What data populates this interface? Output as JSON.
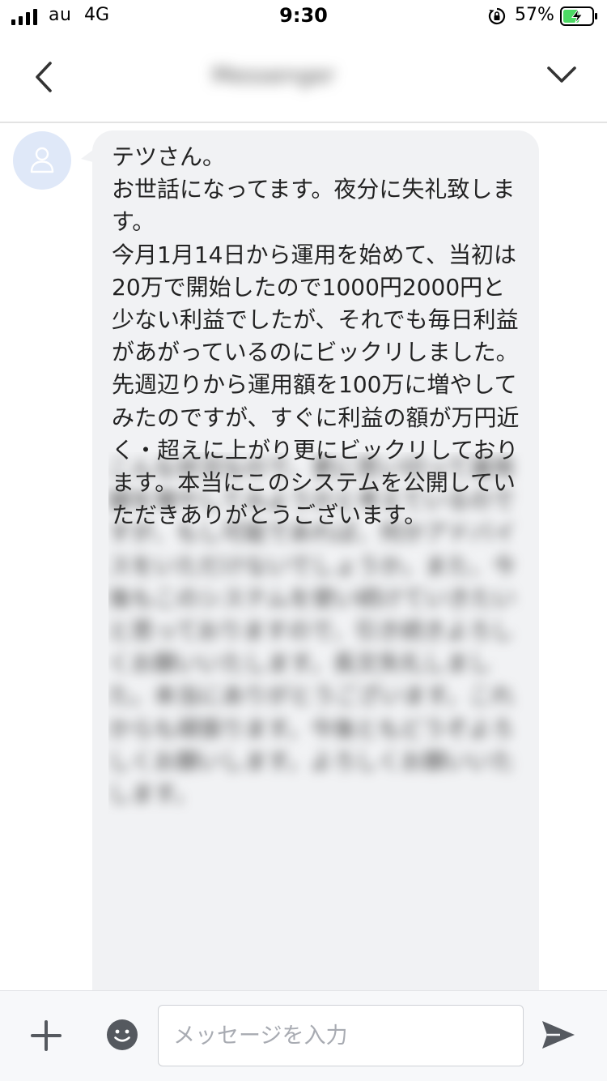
{
  "status_bar": {
    "carrier": "au",
    "network": "4G",
    "time": "9:30",
    "battery_percent": "57%",
    "signal_bars": 4,
    "battery_level": 0.57,
    "charging": true
  },
  "nav": {
    "title": "Messenger"
  },
  "message": {
    "sender_avatar": "person-icon",
    "text": "テツさん。\nお世話になってます。夜分に失礼致します。\n今月1月14日から運用を始めて、当初は20万で開始したので1000円2000円と少ない利益でしたが、それでも毎日利益があがっているのにビックリしました。先週辺りから運用額を100万に増やしてみたのですが、すぐに利益の額が万円近く・超えに上がり更にビックリしております。本当にこのシステムを公開していただきありがとうございます。",
    "blurred_text": "こんな状況なので、更に思い切って運用額を増やしてみようかと考えているのですが、もし可能であれば、何かアドバイスをいただけないでしょうか。また、今後もこのシステムを使い続けていきたいと思っておりますので、引き続きよろしくお願いいたします。長文失礼しました。本当にありがとうございます。これからも頑張ります。今後ともどうぞよろしくお願いします。よろしくお願いいたします。"
  },
  "input_bar": {
    "placeholder": "メッセージを入力",
    "value": ""
  },
  "colors": {
    "bubble": "#f1f2f4",
    "avatar_bg": "#dfe8f8",
    "icon": "#55595f",
    "battery_fill": "#4cd964"
  }
}
